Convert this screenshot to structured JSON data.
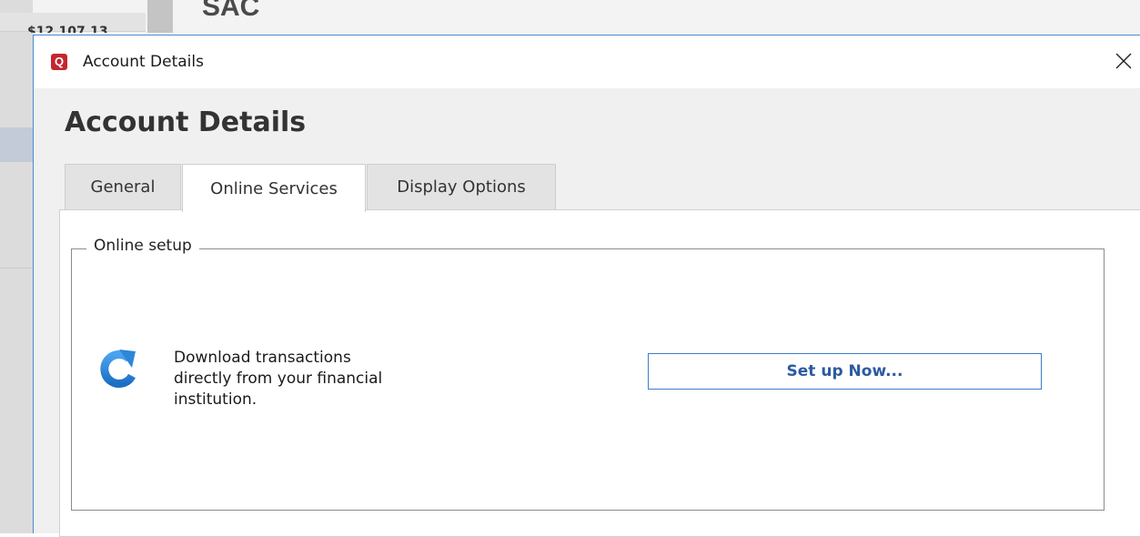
{
  "background_app": {
    "title": "SAC",
    "cutoff_text": "$12,107.13"
  },
  "dialog": {
    "window_title": "Account Details",
    "logo_letter": "Q",
    "heading": "Account Details",
    "tabs": [
      {
        "label": "General",
        "selected": false
      },
      {
        "label": "Online Services",
        "selected": true
      },
      {
        "label": "Display Options",
        "selected": false
      }
    ],
    "group": {
      "legend": "Online setup",
      "description_lines": [
        "Download transactions",
        "directly from your financial",
        "institution."
      ],
      "button_label": "Set up Now...",
      "icon": "refresh-icon"
    }
  },
  "colors": {
    "accent_blue": "#3b7ec9",
    "button_text": "#2b5aa0",
    "logo_red": "#c4262e"
  }
}
